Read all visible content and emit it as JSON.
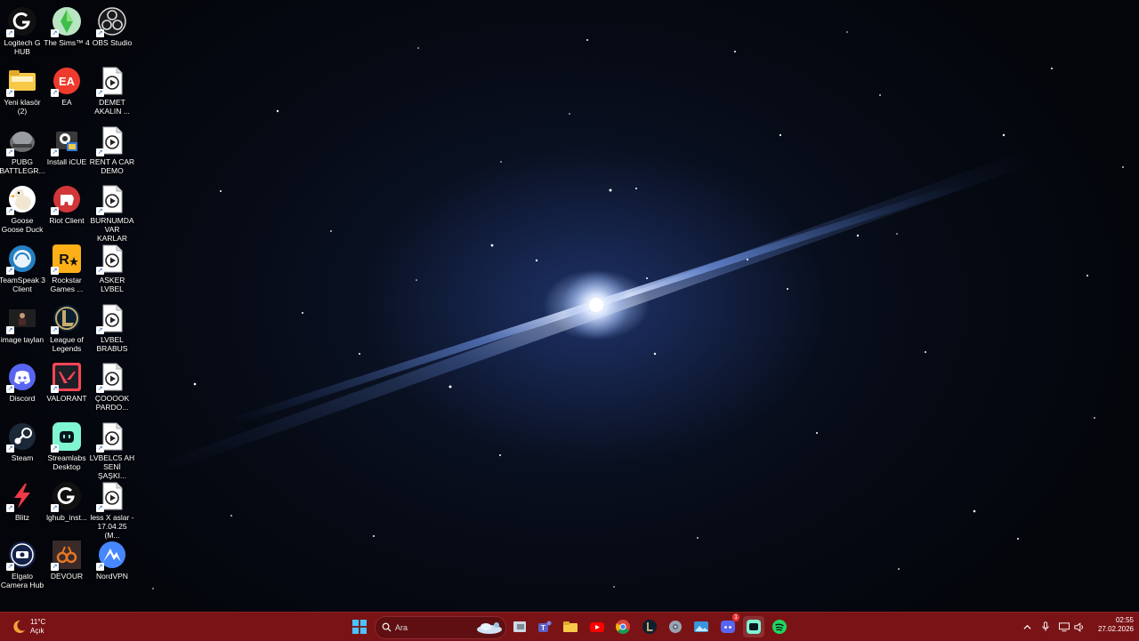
{
  "desktop": {
    "icons": [
      {
        "label": "Logitech G HUB",
        "icon": "logitech-g-icon"
      },
      {
        "label": "The Sims™ 4",
        "icon": "sims-plumbob-icon"
      },
      {
        "label": "OBS Studio",
        "icon": "obs-icon"
      },
      {
        "label": "Yeni klasör (2)",
        "icon": "folder-icon"
      },
      {
        "label": "EA",
        "icon": "ea-icon"
      },
      {
        "label": "DEMET AKALIN ...",
        "icon": "video-file-icon"
      },
      {
        "label": "PUBG BATTLEGR...",
        "icon": "pubg-helmet-icon"
      },
      {
        "label": "Install iCUE",
        "icon": "icue-installer-icon"
      },
      {
        "label": "RENT A CAR DEMO",
        "icon": "video-file-icon"
      },
      {
        "label": "Goose Goose Duck",
        "icon": "goose-icon"
      },
      {
        "label": "Riot Client",
        "icon": "riot-fist-icon"
      },
      {
        "label": "BURNUMDA VAR KARLAR",
        "icon": "video-file-icon"
      },
      {
        "label": "TeamSpeak 3 Client",
        "icon": "teamspeak-icon"
      },
      {
        "label": "Rockstar Games ...",
        "icon": "rockstar-icon"
      },
      {
        "label": "ASKER LVBEL",
        "icon": "video-file-icon"
      },
      {
        "label": "image taylan",
        "icon": "image-thumbnail-icon"
      },
      {
        "label": "League of Legends",
        "icon": "league-icon"
      },
      {
        "label": "LVBEL BRABUS",
        "icon": "video-file-icon"
      },
      {
        "label": "Discord",
        "icon": "discord-icon"
      },
      {
        "label": "VALORANT",
        "icon": "valorant-icon"
      },
      {
        "label": "ÇOOOOK PARDO...",
        "icon": "video-file-icon"
      },
      {
        "label": "Steam",
        "icon": "steam-icon"
      },
      {
        "label": "Streamlabs Desktop",
        "icon": "streamlabs-icon"
      },
      {
        "label": "LVBELC5 AH SENİ ŞAŞKI...",
        "icon": "video-file-icon"
      },
      {
        "label": "Blitz",
        "icon": "blitz-icon"
      },
      {
        "label": "lghub_inst...",
        "icon": "logitech-g-icon"
      },
      {
        "label": "less X aslar - 17.04.25 (M...",
        "icon": "video-file-icon"
      },
      {
        "label": "Elgato Camera Hub",
        "icon": "elgato-camera-icon"
      },
      {
        "label": "DEVOUR",
        "icon": "devour-icon"
      },
      {
        "label": "NordVPN",
        "icon": "nordvpn-icon"
      }
    ]
  },
  "taskbar": {
    "weather": {
      "temp": "11°C",
      "condition": "Açık",
      "icon": "weather-moon-icon"
    },
    "search_placeholder": "Ara",
    "apps": [
      {
        "name": "file-explorer-pane",
        "icon": "task-view-icon"
      },
      {
        "name": "teams",
        "icon": "teams-icon"
      },
      {
        "name": "file-explorer",
        "icon": "folder-icon"
      },
      {
        "name": "youtube",
        "icon": "youtube-icon"
      },
      {
        "name": "chrome",
        "icon": "chrome-icon"
      },
      {
        "name": "league",
        "icon": "league-icon"
      },
      {
        "name": "settings",
        "icon": "gear-icon"
      },
      {
        "name": "photos",
        "icon": "photos-icon"
      },
      {
        "name": "discord",
        "icon": "discord-icon"
      },
      {
        "name": "streamlabs",
        "icon": "streamlabs-icon"
      },
      {
        "name": "spotify",
        "icon": "spotify-icon"
      }
    ],
    "discord_badge": "1",
    "clock": {
      "time": "02:55",
      "date": "27.02.2026"
    }
  }
}
